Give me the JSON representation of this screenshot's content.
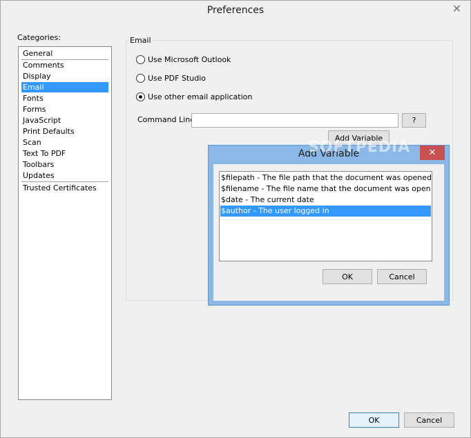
{
  "window": {
    "title": "Preferences",
    "close_glyph": "✕"
  },
  "categories": {
    "label": "Categories:",
    "items": [
      "General",
      "Comments",
      "Display",
      "Email",
      "Fonts",
      "Forms",
      "JavaScript",
      "Print Defaults",
      "Scan",
      "Text To PDF",
      "Toolbars",
      "Updates",
      "Trusted Certificates"
    ],
    "selected": "Email"
  },
  "email": {
    "legend": "Email",
    "options": [
      {
        "label": "Use Microsoft Outlook",
        "checked": false
      },
      {
        "label": "Use PDF Studio",
        "checked": false
      },
      {
        "label": "Use other email application",
        "checked": true
      }
    ],
    "command_line_label": "Command Line:",
    "command_line_value": "",
    "help_label": "?",
    "add_variable_label": "Add Variable"
  },
  "dialog": {
    "title": "Add Variable",
    "close_glyph": "✕",
    "variables": [
      "$filepath - The file path that the document was opened from",
      "$filename - The file name that the document was opened from",
      "$date - The current date",
      "$author - The user logged in"
    ],
    "selected_index": 3,
    "ok_label": "OK",
    "cancel_label": "Cancel"
  },
  "footer": {
    "ok_label": "OK",
    "cancel_label": "Cancel"
  },
  "watermark": "SOFTPEDIA",
  "colors": {
    "selection": "#3399ff",
    "dialog_frame": "#8bb8e6",
    "dialog_close": "#c75050"
  }
}
